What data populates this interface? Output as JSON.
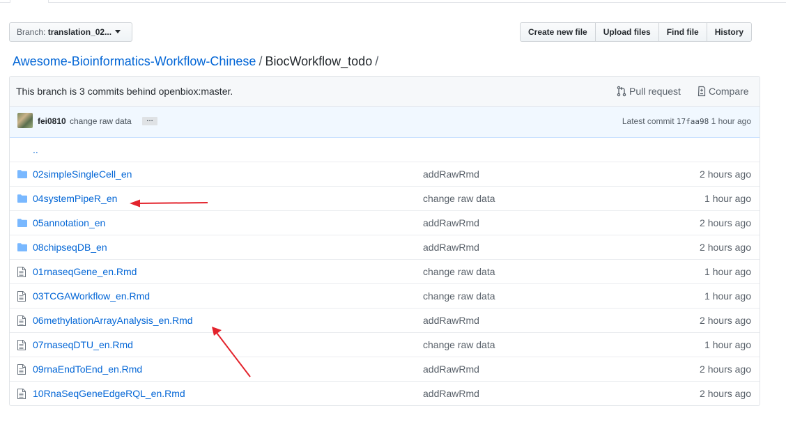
{
  "branch": {
    "label": "Branch:",
    "name": "translation_02..."
  },
  "actions": [
    "Create new file",
    "Upload files",
    "Find file",
    "History"
  ],
  "breadcrumb": {
    "repo": "Awesome-Bioinformatics-Workflow-Chinese",
    "sep": "/",
    "current": "BiocWorkflow_todo",
    "trail": "/"
  },
  "behind": {
    "message": "This branch is 3 commits behind openbiox:master.",
    "pull_request": "Pull request",
    "compare": "Compare"
  },
  "commit": {
    "author": "fei0810",
    "message": "change raw data",
    "ellipsis": "…",
    "latest_label": "Latest commit",
    "sha": "17faa98",
    "age": "1 hour ago"
  },
  "parent_dir": "..",
  "files": [
    {
      "type": "dir",
      "name": "02simpleSingleCell_en",
      "message": "addRawRmd",
      "age": "2 hours ago"
    },
    {
      "type": "dir",
      "name": "04systemPipeR_en",
      "message": "change raw data",
      "age": "1 hour ago"
    },
    {
      "type": "dir",
      "name": "05annotation_en",
      "message": "addRawRmd",
      "age": "2 hours ago"
    },
    {
      "type": "dir",
      "name": "08chipseqDB_en",
      "message": "addRawRmd",
      "age": "2 hours ago"
    },
    {
      "type": "file",
      "name": "01rnaseqGene_en.Rmd",
      "message": "change raw data",
      "age": "1 hour ago"
    },
    {
      "type": "file",
      "name": "03TCGAWorkflow_en.Rmd",
      "message": "change raw data",
      "age": "1 hour ago"
    },
    {
      "type": "file",
      "name": "06methylationArrayAnalysis_en.Rmd",
      "message": "addRawRmd",
      "age": "2 hours ago"
    },
    {
      "type": "file",
      "name": "07rnaseqDTU_en.Rmd",
      "message": "change raw data",
      "age": "1 hour ago"
    },
    {
      "type": "file",
      "name": "09rnaEndToEnd_en.Rmd",
      "message": "addRawRmd",
      "age": "2 hours ago"
    },
    {
      "type": "file",
      "name": "10RnaSeqGeneEdgeRQL_en.Rmd",
      "message": "addRawRmd",
      "age": "2 hours ago"
    }
  ],
  "colors": {
    "link": "#0366d6",
    "folder": "#79b8ff",
    "annotation_arrow": "#e3232c"
  },
  "icons": {
    "dir": "folder-icon",
    "file": "file-icon",
    "pull": "git-pull-request-icon",
    "compare": "diff-icon",
    "arrow": "red-arrow-annotation"
  }
}
